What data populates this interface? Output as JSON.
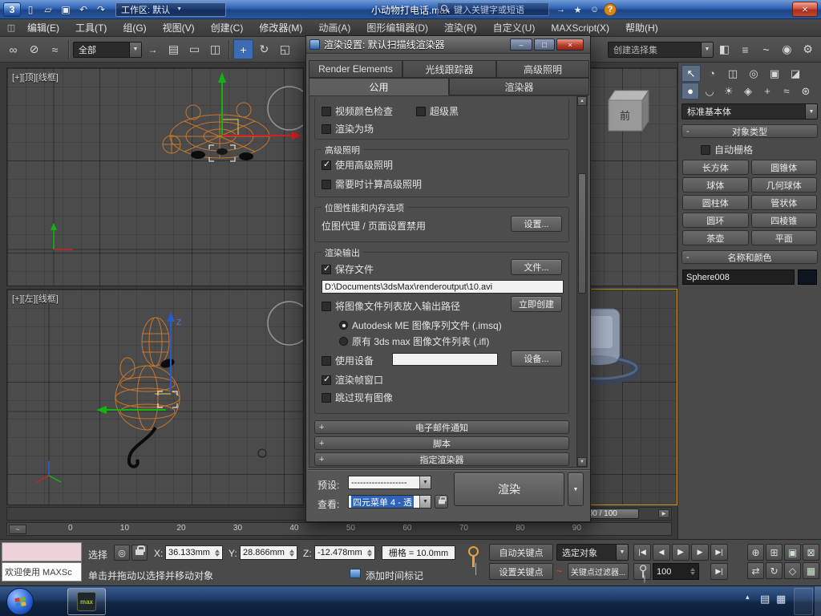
{
  "window": {
    "workspace": "工作区: 默认",
    "title": "小动物打电话.max",
    "search_placeholder": "键入关键字或短语"
  },
  "menubar": [
    "编辑(E)",
    "工具(T)",
    "组(G)",
    "视图(V)",
    "创建(C)",
    "修改器(M)",
    "动画(A)",
    "图形编辑器(D)",
    "渲染(R)",
    "自定义(U)",
    "MAXScript(X)",
    "帮助(H)"
  ],
  "toolbar": {
    "filter_value": "全部",
    "selection_set_placeholder": "创建选择集"
  },
  "viewports": {
    "top_label": "[+][顶][线框]",
    "left_label": "[+][左][线框]",
    "front_cube": "前",
    "axis_z": "Z"
  },
  "dialog": {
    "title": "渲染设置: 默认扫描线渲染器",
    "tabs_top": [
      "Render Elements",
      "光线跟踪器",
      "高级照明"
    ],
    "tabs_bottom": [
      "公用",
      "渲染器"
    ],
    "common": {
      "video_color_check": "视频颜色检查",
      "super_black": "超级黑",
      "render_to_fields": "渲染为场"
    },
    "adv_lighting": {
      "title": "高级照明",
      "use": "使用高级照明",
      "compute": "需要时计算高级照明"
    },
    "bitmap": {
      "title": "位图性能和内存选项",
      "status": "位图代理 / 页面设置禁用",
      "setup_button": "设置..."
    },
    "output": {
      "title": "渲染输出",
      "save_file": "保存文件",
      "files_button": "文件...",
      "path": "D:\\Documents\\3dsMax\\renderoutput\\10.avi",
      "put_list": "将图像文件列表放入输出路径",
      "create_now_button": "立即创建",
      "radio_imsq": "Autodesk ME 图像序列文件 (.imsq)",
      "radio_ifl": "原有 3ds max 图像文件列表 (.ifl)",
      "use_device": "使用设备",
      "devices_button": "设备...",
      "frame_window": "渲染帧窗口",
      "skip_existing": "跳过现有图像"
    },
    "rollouts": [
      "电子邮件通知",
      "脚本",
      "指定渲染器"
    ],
    "footer": {
      "preset_label": "预设:",
      "preset_value": "-------------------",
      "view_label": "查看:",
      "view_value": "四元菜单 4 - 透",
      "render_button": "渲染"
    }
  },
  "panel": {
    "dropdown": "标准基本体",
    "object_type_title": "对象类型",
    "autogrid": "自动栅格",
    "buttons": [
      "长方体",
      "圆锥体",
      "球体",
      "几何球体",
      "圆柱体",
      "管状体",
      "圆环",
      "四棱锥",
      "茶壶",
      "平面"
    ],
    "name_color_title": "名称和颜色",
    "object_name": "Sphere008"
  },
  "timeline": {
    "handle": "100 / 100",
    "ticks": [
      "0",
      "10",
      "20",
      "30",
      "40",
      "50",
      "60",
      "70",
      "80",
      "90"
    ]
  },
  "status": {
    "welcome": "欢迎使用 MAXSc",
    "selection_label": "选择",
    "x_label": "X:",
    "x_value": "36.133mm",
    "y_label": "Y:",
    "y_value": "28.866mm",
    "z_label": "Z:",
    "z_value": "-12.478mm",
    "grid_value": "栅格 = 10.0mm",
    "prompt": "单击并拖动以选择并移动对象",
    "add_time_tag": "添加时间标记",
    "auto_key": "自动关键点",
    "set_key": "设置关键点",
    "selected_combo": "选定对象",
    "key_filters": "关键点过滤器...",
    "frame_field": "100"
  },
  "taskbar": {
    "max_label": "max"
  },
  "icons": {
    "logo": "3",
    "new_doc": "▯",
    "open_folder": "▱",
    "save": "▣",
    "undo": "↶",
    "redo": "↷",
    "combo_arrow": "▼",
    "up_arrow": "▲",
    "down_arrow": "▼",
    "search_go": "→",
    "favorites": "★",
    "signin": "☺",
    "help": "?",
    "close": "×",
    "minimize": "–",
    "maximize": "□",
    "link": "∞",
    "unlink": "⊘",
    "bind_spacewarp": "≈",
    "select_by_name": "▤",
    "region_rect": "▭",
    "window_crossing": "◫",
    "move": "+",
    "rotate": "↻",
    "scale": "◱",
    "mirror": "◧",
    "align": "≡",
    "curve_editor": "~",
    "material_editor": "◉",
    "render_setup": "⚙",
    "plus": "+",
    "minus": "-",
    "isolate": "◎",
    "go_start": "|◀",
    "prev_frame": "◀",
    "play": "▶",
    "next_frame": "▶",
    "go_end": "▶|",
    "key_wave": "~",
    "zoom": "⊕",
    "zoom_all": "⊞",
    "zoom_extents": "▣",
    "zoom_extents_all": "⊠",
    "pan": "⇄",
    "orbit": "↻",
    "fov": "◇",
    "max_viewport": "▦",
    "create_tab": "↖",
    "modify_tab": "◔",
    "hierarchy_tab": "◫",
    "motion_tab": "◎",
    "display_tab": "▣",
    "utilities_tab": "◪",
    "geometry": "●",
    "shapes": "◡",
    "lights": "☀",
    "cameras": "◈",
    "helpers": "+",
    "spacewarps": "≈",
    "systems": "⊛",
    "mini_curve": "~",
    "tray_a": "▤",
    "tray_b": "▦",
    "hidden_icons": "▴"
  },
  "colors": {
    "titlebar_blue": "#2f62b5",
    "wireframe_orange": "#c8762a",
    "gizmo_green": "#12b412",
    "gizmo_red": "#d02020",
    "gizmo_blue": "#2a5ad0",
    "active_viewport_border": "#c9991f",
    "selection_highlight": "#2e63b8",
    "close_red": "#c0392b"
  }
}
